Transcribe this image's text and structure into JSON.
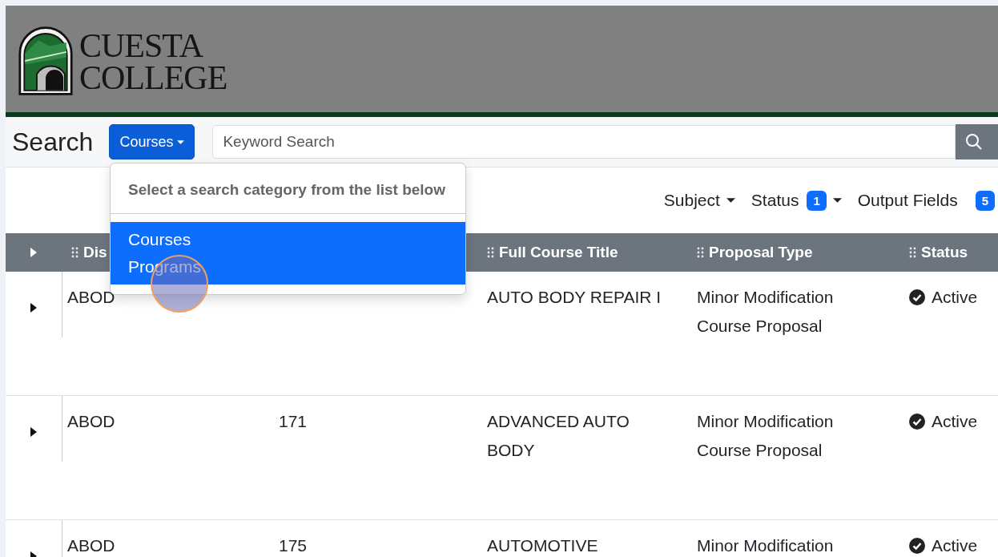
{
  "logo": {
    "line_1": "CUESTA",
    "line_2": "COLLEGE"
  },
  "search": {
    "label": "Search",
    "category_button": "Courses",
    "placeholder": "Keyword Search"
  },
  "category_menu": {
    "header": "Select a search category from the list below",
    "items": [
      {
        "label": "Courses",
        "selected": true
      },
      {
        "label": "Programs",
        "selected": true
      }
    ]
  },
  "filters": [
    {
      "label": "Subject"
    },
    {
      "label": "Status",
      "badge": "1"
    },
    {
      "label": "Output Fields",
      "badge": "5"
    }
  ],
  "table": {
    "columns": [
      {
        "label": "Dis"
      },
      {},
      {
        "label": "Full Course Title"
      },
      {
        "label": "Proposal Type"
      },
      {
        "label": "Status"
      }
    ],
    "rows": [
      {
        "cells": [
          "ABOD",
          "",
          "AUTO BODY REPAIR I",
          "Minor Modification Course Proposal",
          "Active"
        ]
      },
      {
        "cells": [
          "ABOD",
          "171",
          "ADVANCED AUTO BODY",
          "Minor Modification Course Proposal",
          "Active"
        ]
      },
      {
        "cells": [
          "ABOD",
          "175",
          "AUTOMOTIVE",
          "Minor Modification",
          "Active"
        ]
      }
    ]
  }
}
